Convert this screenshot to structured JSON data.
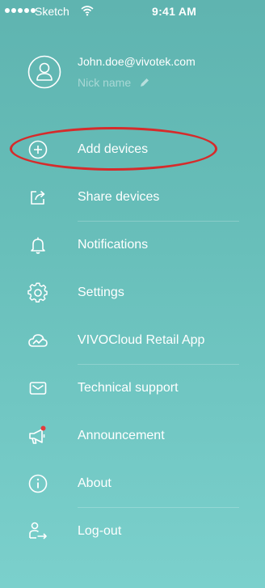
{
  "status_bar": {
    "carrier": "Sketch",
    "time": "9:41 AM"
  },
  "profile": {
    "email": "John.doe@vivotek.com",
    "nick_name": "Nick name"
  },
  "menu": {
    "items": [
      {
        "label": "Add devices",
        "icon": "add-circle-icon"
      },
      {
        "label": "Share devices",
        "icon": "share-icon"
      },
      {
        "label": "Notifications",
        "icon": "bell-icon"
      },
      {
        "label": "Settings",
        "icon": "gear-icon"
      },
      {
        "label": "VIVOCloud Retail App",
        "icon": "cloud-chart-icon"
      },
      {
        "label": "Technical support",
        "icon": "mail-icon"
      },
      {
        "label": "Announcement",
        "icon": "megaphone-icon"
      },
      {
        "label": "About",
        "icon": "info-icon"
      },
      {
        "label": "Log-out",
        "icon": "logout-user-icon"
      }
    ]
  },
  "colors": {
    "background_top": "#5fb4b0",
    "background_bottom": "#7bd0cc",
    "text": "#ffffff",
    "highlight": "#d62b2b",
    "badge": "#e23b3b"
  }
}
